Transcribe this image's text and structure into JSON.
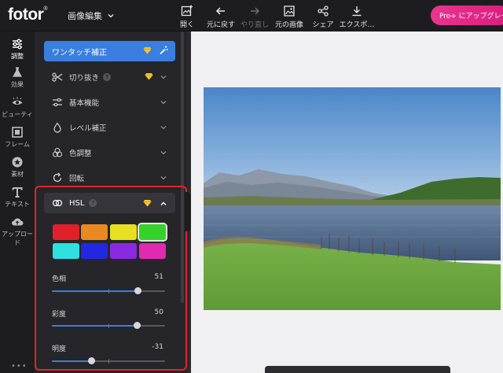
{
  "app": {
    "logo": "fotor",
    "logo_mark": "®",
    "mode_label": "画像編集"
  },
  "toolbar": {
    "open": "開く",
    "undo": "元に戻す",
    "redo": "やり直し",
    "original": "元の画像",
    "share": "シェア",
    "export": "エクスポ…",
    "pro_button": "Pro+ にアップグレードする"
  },
  "rail": {
    "items": [
      {
        "label": "調整",
        "icon": "sliders-icon",
        "active": true
      },
      {
        "label": "効果",
        "icon": "flask-icon"
      },
      {
        "label": "ビューティ",
        "icon": "eye-icon"
      },
      {
        "label": "フレーム",
        "icon": "frame-icon"
      },
      {
        "label": "素材",
        "icon": "star-badge-icon"
      },
      {
        "label": "テキスト",
        "icon": "text-icon"
      },
      {
        "label": "アップロード",
        "icon": "cloud-upload-icon"
      }
    ],
    "more": "•••"
  },
  "panel": {
    "one_click": "ワンタッチ補正",
    "sections": [
      {
        "label": "切り抜き",
        "icon": "scissors-icon",
        "help": "?",
        "premium": true
      },
      {
        "label": "基本機能",
        "icon": "sliders-icon"
      },
      {
        "label": "レベル補正",
        "icon": "drop-icon"
      },
      {
        "label": "色調整",
        "icon": "color-circles-icon"
      },
      {
        "label": "回転",
        "icon": "rotate-icon"
      }
    ],
    "hsl": {
      "title": "HSL",
      "help": "?",
      "swatches": [
        "#e0202a",
        "#e88a20",
        "#e6e020",
        "#35d22a",
        "#2ee0e0",
        "#2228e0",
        "#8a2ae0",
        "#e02ab0"
      ],
      "selected_swatch": 3,
      "sliders": [
        {
          "label": "色相",
          "value": "51",
          "fraction": 0.76
        },
        {
          "label": "彩度",
          "value": "50",
          "fraction": 0.75
        },
        {
          "label": "明度",
          "value": "-31",
          "fraction": 0.35
        }
      ]
    }
  },
  "colors": {
    "accent": "#3a7fe0",
    "highlight_frame": "#e0252a",
    "pro": "#e8358f"
  }
}
